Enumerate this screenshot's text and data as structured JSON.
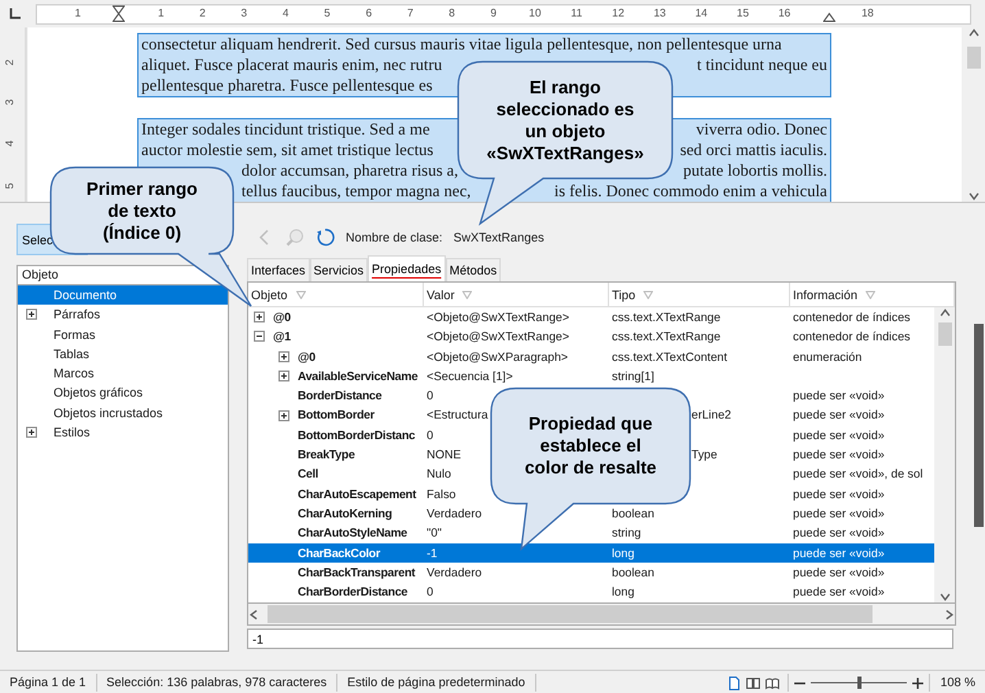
{
  "ruler": {
    "horizontal": [
      "1",
      "1",
      "2",
      "3",
      "4",
      "5",
      "6",
      "7",
      "8",
      "9",
      "10",
      "11",
      "12",
      "13",
      "14",
      "15",
      "16",
      "18"
    ],
    "vertical": [
      "2",
      "3",
      "4",
      "5"
    ]
  },
  "document": {
    "paragraphs": [
      {
        "lines": [
          {
            "starts_covered": false,
            "segments": [
              "consectetur aliquam hendrerit. Sed cursus mauris vitae ligula pellentesque, non pellentesque urna"
            ]
          },
          {
            "starts_covered": false,
            "segments": [
              "aliquet. Fusce placerat mauris enim, nec rutru",
              "t tincidunt neque eu"
            ]
          },
          {
            "starts_covered": false,
            "segments": [
              "pellentesque pharetra. Fusce pellentesque es"
            ]
          }
        ]
      },
      {
        "lines": [
          {
            "starts_covered": false,
            "segments": [
              "Integer sodales tincidunt tristique. Sed a me",
              "viverra odio. Donec"
            ]
          },
          {
            "starts_covered": false,
            "segments": [
              "auctor molestie sem, sit amet tristique lectus",
              "sed orci mattis iaculis."
            ]
          },
          {
            "starts_covered": true,
            "segments": [
              "dolor accumsan, pharetra risus a,",
              "putate lobortis mollis."
            ]
          },
          {
            "starts_covered": true,
            "segments": [
              "tellus faucibus, tempor magna nec,",
              "is felis. Donec commodo enim a vehicula"
            ]
          }
        ]
      }
    ]
  },
  "inspector": {
    "select_button": "Selec",
    "tree": {
      "header": "Objeto",
      "items": [
        {
          "label": "Documento",
          "selected": true
        },
        {
          "label": "Párrafos",
          "selected": false,
          "expanded": false
        },
        {
          "label": "Formas",
          "selected": false
        },
        {
          "label": "Tablas",
          "selected": false
        },
        {
          "label": "Marcos",
          "selected": false
        },
        {
          "label": "Objetos gráficos",
          "selected": false
        },
        {
          "label": "Objetos incrustados",
          "selected": false
        },
        {
          "label": "Estilos",
          "selected": false,
          "expanded": false
        }
      ]
    },
    "class_label": "Nombre de clase:",
    "class_name": "SwXTextRanges",
    "tabs": [
      {
        "label": "Interfaces",
        "selected": false
      },
      {
        "label": "Servicios",
        "selected": false
      },
      {
        "label": "Propiedades",
        "selected": true
      },
      {
        "label": "Métodos",
        "selected": false
      }
    ],
    "table": {
      "columns": [
        "Objeto",
        "Valor",
        "Tipo",
        "Información"
      ],
      "rows": [
        {
          "name": "@0",
          "value": "<Objeto@SwXTextRange>",
          "type": "css.text.XTextRange",
          "info": "contenedor de índices",
          "expanded": false,
          "selected": false
        },
        {
          "name": "@1",
          "value": "<Objeto@SwXTextRange>",
          "type": "css.text.XTextRange",
          "info": "contenedor de índices",
          "expanded": true,
          "selected": false,
          "children": [
            {
              "name": "@0",
              "value": "<Objeto@SwXParagraph>",
              "type": "css.text.XTextContent",
              "info": "enumeración",
              "expanded": false,
              "selected": false
            },
            {
              "name": "AvailableServiceName",
              "value": "<Secuencia [1]>",
              "type": "string[1]",
              "expanded": false,
              "selected": false
            },
            {
              "name": "BorderDistance",
              "value": "0",
              "info": "puede ser «void»",
              "selected": false
            },
            {
              "name": "BottomBorder",
              "value": "<Estructura",
              "type": "erLine2",
              "type_start_covered": true,
              "info": "puede ser «void»",
              "expanded": false,
              "selected": false
            },
            {
              "name": "BottomBorderDistanc",
              "value": "0",
              "info": "puede ser «void»",
              "selected": false
            },
            {
              "name": "BreakType",
              "value": "NONE",
              "type": "Type",
              "type_start_covered": true,
              "info": "puede ser «void»",
              "selected": false
            },
            {
              "name": "Cell",
              "value": "Nulo",
              "info": "puede ser «void», de sol",
              "selected": false
            },
            {
              "name": "CharAutoEscapement",
              "value": "Falso",
              "info": "puede ser «void»",
              "selected": false
            },
            {
              "name": "CharAutoKerning",
              "value": "Verdadero",
              "type": "boolean",
              "info": "puede ser «void»",
              "selected": false
            },
            {
              "name": "CharAutoStyleName",
              "value": "\"0\"",
              "type": "string",
              "info": "puede ser «void»",
              "selected": false
            },
            {
              "name": "CharBackColor",
              "value": "-1",
              "type": "long",
              "info": "puede ser «void»",
              "selected": true
            },
            {
              "name": "CharBackTransparent",
              "value": "Verdadero",
              "type": "boolean",
              "info": "puede ser «void»",
              "selected": false
            },
            {
              "name": "CharBorderDistance",
              "value": "0",
              "type": "long",
              "info": "puede ser «void»",
              "selected": false
            }
          ]
        }
      ]
    },
    "value_field": "-1"
  },
  "callouts": [
    {
      "text": "Primer rango\nde texto\n(Índice 0)"
    },
    {
      "text": "El rango\nseleccionado es\nun objeto\n«SwXTextRanges»"
    },
    {
      "text": "Propiedad que\nestablece el\ncolor de resalte"
    }
  ],
  "status_bar": {
    "page": "Página 1 de 1",
    "selection": "Selección: 136 palabras, 978 caracteres",
    "page_style": "Estilo de página predeterminado",
    "zoom_slider": {
      "level": 0.5
    },
    "zoom": "108 %"
  }
}
